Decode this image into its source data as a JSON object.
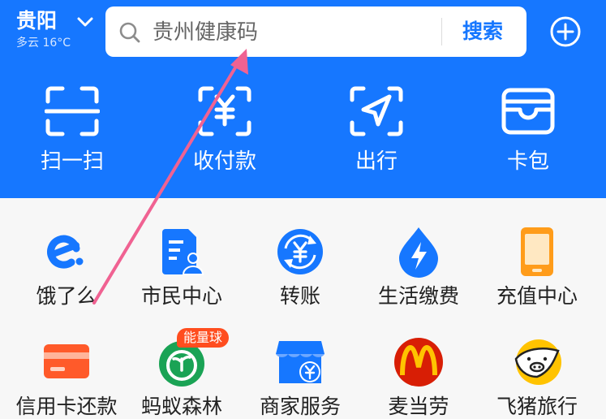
{
  "header": {
    "city": "贵阳",
    "weather": "多云 16°C",
    "search": {
      "placeholder": "贵州健康码",
      "button_label": "搜索"
    }
  },
  "quick_actions": [
    {
      "label": "扫一扫",
      "icon": "scan-icon"
    },
    {
      "label": "收付款",
      "icon": "payment-code-icon"
    },
    {
      "label": "出行",
      "icon": "travel-icon"
    },
    {
      "label": "卡包",
      "icon": "card-wallet-icon"
    }
  ],
  "services": [
    {
      "label": "饿了么",
      "icon": "eleme-icon",
      "color": "#1677ff"
    },
    {
      "label": "市民中心",
      "icon": "citizen-center-icon",
      "color": "#1677ff"
    },
    {
      "label": "转账",
      "icon": "transfer-icon",
      "color": "#1677ff"
    },
    {
      "label": "生活缴费",
      "icon": "utility-payment-icon",
      "color": "#1677ff"
    },
    {
      "label": "充值中心",
      "icon": "recharge-center-icon",
      "color": "#ff9c1a"
    },
    {
      "label": "信用卡还款",
      "icon": "credit-card-icon",
      "color": "#ff5a2a"
    },
    {
      "label": "蚂蚁森林",
      "icon": "ant-forest-icon",
      "color": "#1aa355",
      "badge": "能量球"
    },
    {
      "label": "商家服务",
      "icon": "merchant-service-icon",
      "color": "#1677ff"
    },
    {
      "label": "麦当劳",
      "icon": "mcdonalds-icon",
      "color": "#d81e05"
    },
    {
      "label": "飞猪旅行",
      "icon": "fliggy-icon",
      "color": "#ffc300"
    }
  ],
  "colors": {
    "brand": "#1677ff",
    "annotation_arrow": "#f06292"
  }
}
